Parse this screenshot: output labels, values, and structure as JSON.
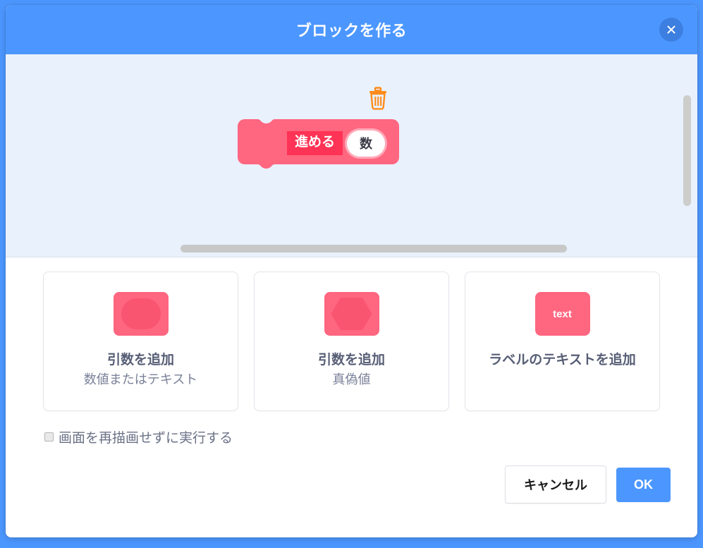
{
  "dialog": {
    "title": "ブロックを作る",
    "close_icon": "close-icon"
  },
  "workspace": {
    "background_color": "#E9F1FC",
    "trash_icon": "trash-icon",
    "block": {
      "label": "進める",
      "argument_value": "数",
      "block_color": "#FF6680",
      "label_color": "#FF3355"
    }
  },
  "options": [
    {
      "icon": "round-input-icon",
      "icon_glyph": "",
      "title": "引数を追加",
      "subtitle": "数値またはテキスト"
    },
    {
      "icon": "boolean-input-icon",
      "icon_glyph": "",
      "title": "引数を追加",
      "subtitle": "真偽値"
    },
    {
      "icon": "label-text-icon",
      "icon_glyph": "text",
      "title": "ラベルのテキストを追加",
      "subtitle": ""
    }
  ],
  "checkbox": {
    "label": "画面を再描画せずに実行する",
    "checked": false
  },
  "footer": {
    "cancel_label": "キャンセル",
    "ok_label": "OK",
    "ok_color": "#4C97FF"
  }
}
